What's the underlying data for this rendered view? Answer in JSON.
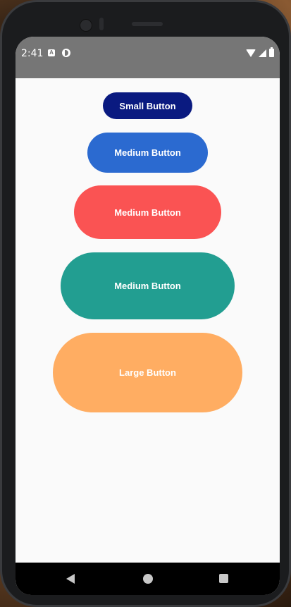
{
  "status_bar": {
    "time": "2:41",
    "notification_icons": [
      "android-auto-icon",
      "app-notification-icon"
    ],
    "system_icons": [
      "wifi-icon",
      "cell-signal-icon",
      "battery-icon"
    ],
    "background_color": "#767676"
  },
  "buttons": [
    {
      "label": "Small Button",
      "color": "#0a1a80"
    },
    {
      "label": "Medium Button",
      "color": "#2b6ad0"
    },
    {
      "label": "Medium Button",
      "color": "#fa5353"
    },
    {
      "label": "Medium Button",
      "color": "#229e91"
    },
    {
      "label": "Large Button",
      "color": "#ffad62"
    }
  ],
  "navigation_bar": {
    "icons": [
      "back-icon",
      "home-icon",
      "recents-icon"
    ]
  }
}
